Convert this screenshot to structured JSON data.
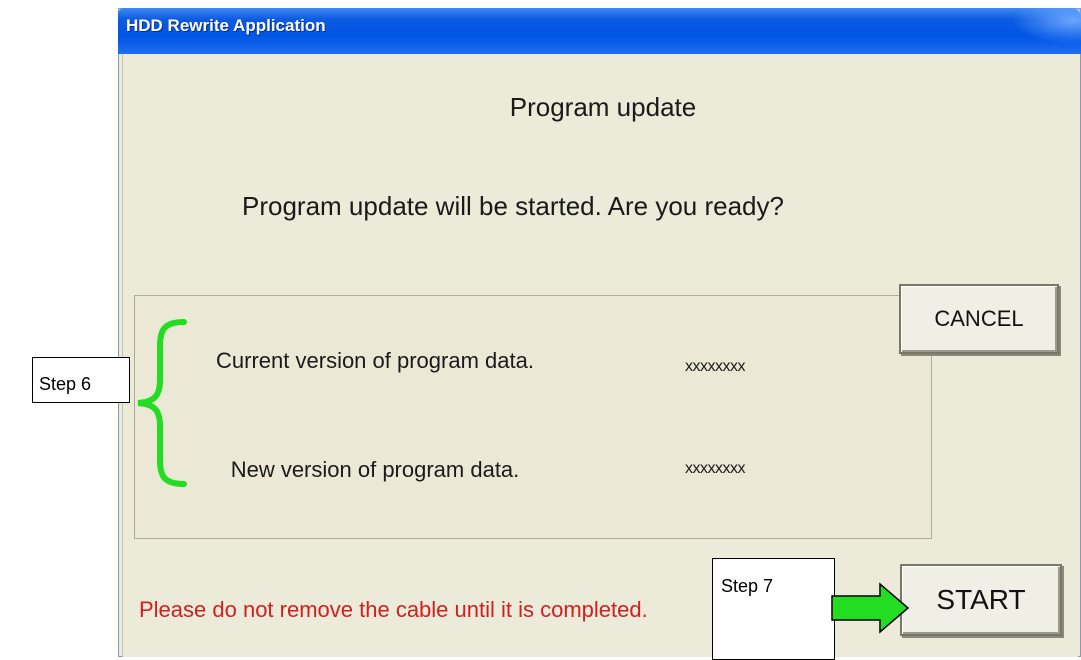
{
  "window": {
    "title": "HDD Rewrite Application"
  },
  "dialog": {
    "heading": "Program update",
    "question": "Program update will be started.  Are you ready?",
    "current_version_label": "Current version of program data.",
    "current_version_value": "xxxxxxxx",
    "new_version_label": "New version of program data.",
    "new_version_value": "xxxxxxxx",
    "warning": "Please do not remove the cable until it is completed.",
    "cancel_label": "CANCEL",
    "start_label": "START"
  },
  "annotations": {
    "step6": "Step 6",
    "step7": "Step 7",
    "highlight_color": "#22dd22"
  },
  "colors": {
    "titlebar": "#0055e5",
    "warning_text": "#d02020",
    "window_bg": "#ecead8"
  }
}
